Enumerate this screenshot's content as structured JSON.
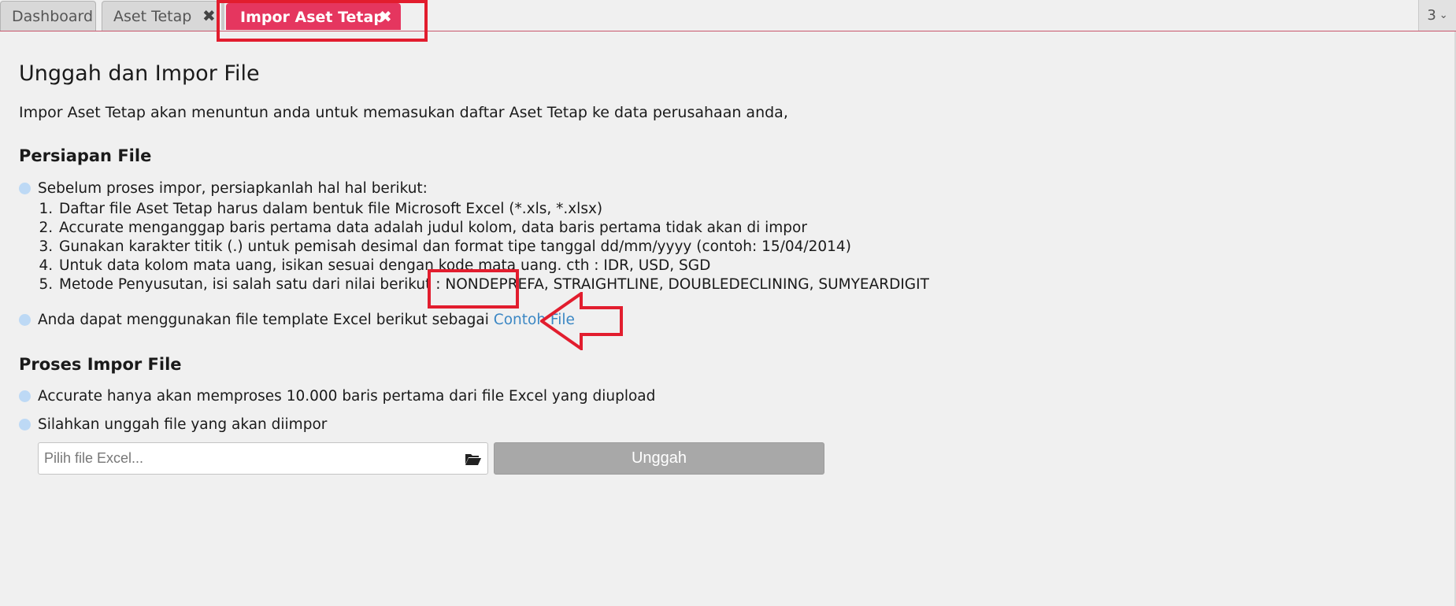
{
  "tabs": [
    {
      "label": "Dashboard"
    },
    {
      "label": "Aset Tetap",
      "close_icon": "✖"
    },
    {
      "label": "Impor Aset Tetap",
      "close_icon": "✖",
      "active": true
    }
  ],
  "tab_counter": {
    "count": "3",
    "chevron": "⌄"
  },
  "page": {
    "title": "Unggah dan Impor File",
    "intro": "Impor Aset Tetap akan menuntun anda untuk memasukan daftar Aset Tetap ke data perusahaan anda,"
  },
  "persiapan": {
    "heading": "Persiapan File",
    "bullet1": "Sebelum proses impor, persiapkanlah hal hal berikut:",
    "steps": [
      "Daftar file Aset Tetap harus dalam bentuk file Microsoft Excel (*.xls, *.xlsx)",
      "Accurate menganggap baris pertama data adalah judul kolom, data baris pertama tidak akan di impor",
      "Gunakan karakter titik (.) untuk pemisah desimal dan format tipe tanggal dd/mm/yyyy (contoh: 15/04/2014)",
      "Untuk data kolom mata uang, isikan sesuai dengan kode mata uang. cth : IDR, USD, SGD",
      "Metode Penyusutan, isi salah satu dari nilai berikut : NONDEPREFA, STRAIGHTLINE, DOUBLEDECLINING, SUMYEARDIGIT"
    ],
    "bullet2": "Anda dapat menggunakan file template Excel berikut sebagai",
    "sample_link": "Contoh File"
  },
  "proses": {
    "heading": "Proses Impor File",
    "bullet1": "Accurate hanya akan memproses 10.000 baris pertama dari file Excel yang diupload",
    "bullet2": "Silahkan unggah file yang akan diimpor",
    "file_placeholder": "Pilih file Excel...",
    "file_value": "",
    "upload_label": "Unggah"
  },
  "colors": {
    "active_tab": "#e5365f",
    "highlight": "#e21d2e",
    "link": "#3b87c4",
    "bullet": "#bdd9f5",
    "button_disabled": "#a8a8a8"
  },
  "icons": [
    "close-icon",
    "chevron-down-icon",
    "folder-open-icon",
    "arrow-left-outline-icon"
  ]
}
